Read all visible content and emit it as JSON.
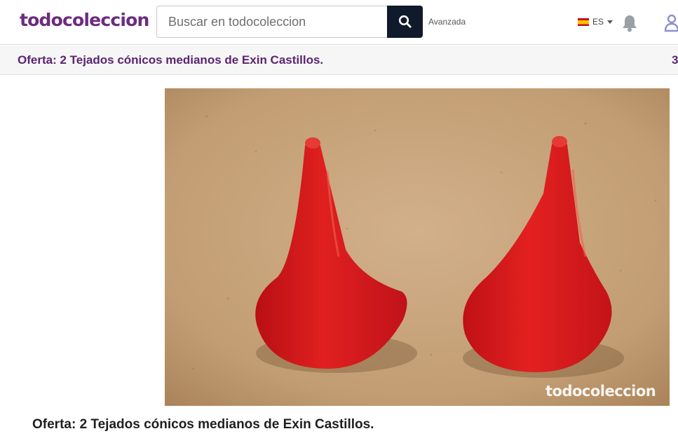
{
  "header": {
    "logo": "todocoleccion",
    "search": {
      "placeholder": "Buscar en todocoleccion",
      "value": ""
    },
    "advanced_link": "Avanzada",
    "language": "ES"
  },
  "subbar": {
    "title": "Oferta: 2 Tejados cónicos medianos de Exin Castillos.",
    "right_text": "3"
  },
  "product": {
    "image_watermark": "todocoleccion",
    "title": "Oferta: 2 Tejados cónicos medianos de Exin Castillos."
  },
  "colors": {
    "brand": "#6d2a7f",
    "search_button": "#0f1a2b",
    "cone_red": "#d8171b",
    "background_board": "#c29d73"
  },
  "icons": [
    "search-icon",
    "spain-flag-icon",
    "caret-down-icon",
    "bell-icon",
    "user-icon"
  ]
}
